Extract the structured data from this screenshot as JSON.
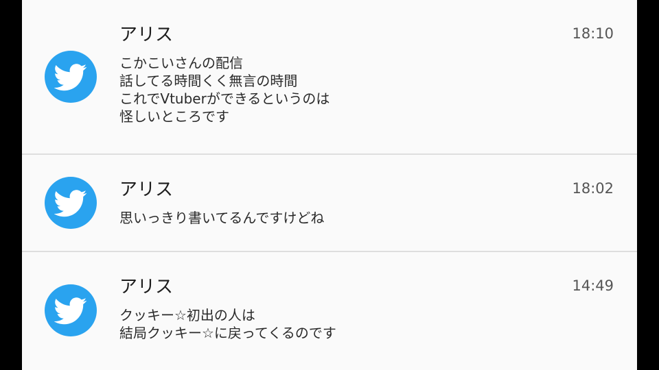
{
  "notifications": [
    {
      "sender": "アリス",
      "time": "18:10",
      "lines": [
        "こかこいさんの配信",
        "話してる時間くく無言の時間",
        "これでVtuberができるというのは",
        "怪しいところです"
      ],
      "icon": "twitter-icon"
    },
    {
      "sender": "アリス",
      "time": "18:02",
      "lines": [
        "思いっきり書いてるんですけどね"
      ],
      "icon": "twitter-icon"
    },
    {
      "sender": "アリス",
      "time": "14:49",
      "lines": [
        "クッキー☆初出の人は",
        "結局クッキー☆に戻ってくるのです"
      ],
      "icon": "twitter-icon"
    }
  ],
  "colors": {
    "accent": "#2aa3ef",
    "card": "#fafafa",
    "divider": "#dedede"
  }
}
